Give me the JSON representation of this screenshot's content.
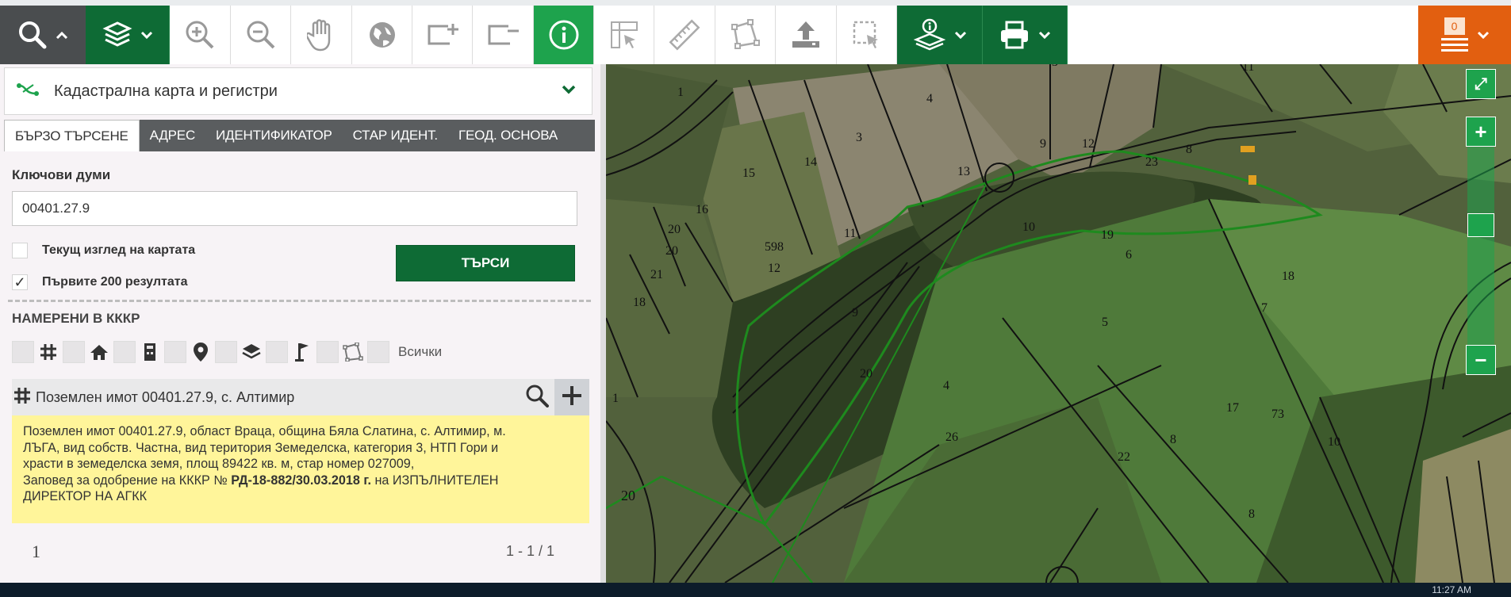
{
  "toolbar": {
    "notification_count": "0",
    "buttons": [
      "search",
      "layers",
      "zoom-in",
      "zoom-out",
      "pan",
      "full-extent",
      "zoom-to-rect",
      "zoom-out-rect",
      "identify",
      "coordinates",
      "measure-distance",
      "measure-area",
      "upload",
      "select-area",
      "layer-info",
      "print"
    ]
  },
  "panel": {
    "layer_select": "Кадастрална карта и регистри",
    "tabs": [
      "БЪРЗО ТЪРСЕНЕ",
      "АДРЕС",
      "ИДЕНТИФИКАТОР",
      "СТАР ИДЕНТ.",
      "ГЕОД. ОСНОВА"
    ],
    "keywords_label": "Ключови думи",
    "keywords_value": "00401.27.9",
    "current_view_label": "Текущ изглед на картата",
    "current_view_checked": false,
    "first200_label": "Първите 200 резултата",
    "first200_checked": true,
    "first200_mark": "✓",
    "search_button": "ТЪРСИ",
    "found_heading": "НАМЕРЕНИ В КККР",
    "all_label": "Всички",
    "result_title": "Поземлен имот 00401.27.9, с. Алтимир",
    "info_line1": "Поземлен имот 00401.27.9, област Враца, община Бяла Слатина, с. Алтимир, м.",
    "info_line2": "ЛЪГА, вид собств. Частна, вид територия Земеделска, категория 3, НТП Гори и",
    "info_line3": "храсти в земеделска земя, площ 89422 кв. м, стар номер 027009,",
    "info_line4_pre": "Заповед за одобрение на КККР № ",
    "info_order": "РД-18-882/30.03.2018 г.",
    "info_line4_post": " на ИЗПЪЛНИТЕЛЕН",
    "info_line5": "ДИРЕКТОР НА АГКК",
    "page_number": "1",
    "page_range": "1 - 1 / 1"
  },
  "map": {
    "parcel_labels": [
      "1",
      "4",
      "3",
      "3",
      "14",
      "15",
      "16",
      "20",
      "20",
      "21",
      "18",
      "13",
      "9",
      "12",
      "8",
      "23",
      "19",
      "10",
      "11",
      "598",
      "12",
      "6",
      "9",
      "5",
      "7",
      "18",
      "20",
      "4",
      "26",
      "8",
      "22",
      "73",
      "10",
      "1",
      "17",
      "8",
      "11",
      "20"
    ],
    "highlight_color": "#1e8a1e",
    "boundary_color": "#111111"
  },
  "taskbar": {
    "clock": "11:27 AM"
  }
}
